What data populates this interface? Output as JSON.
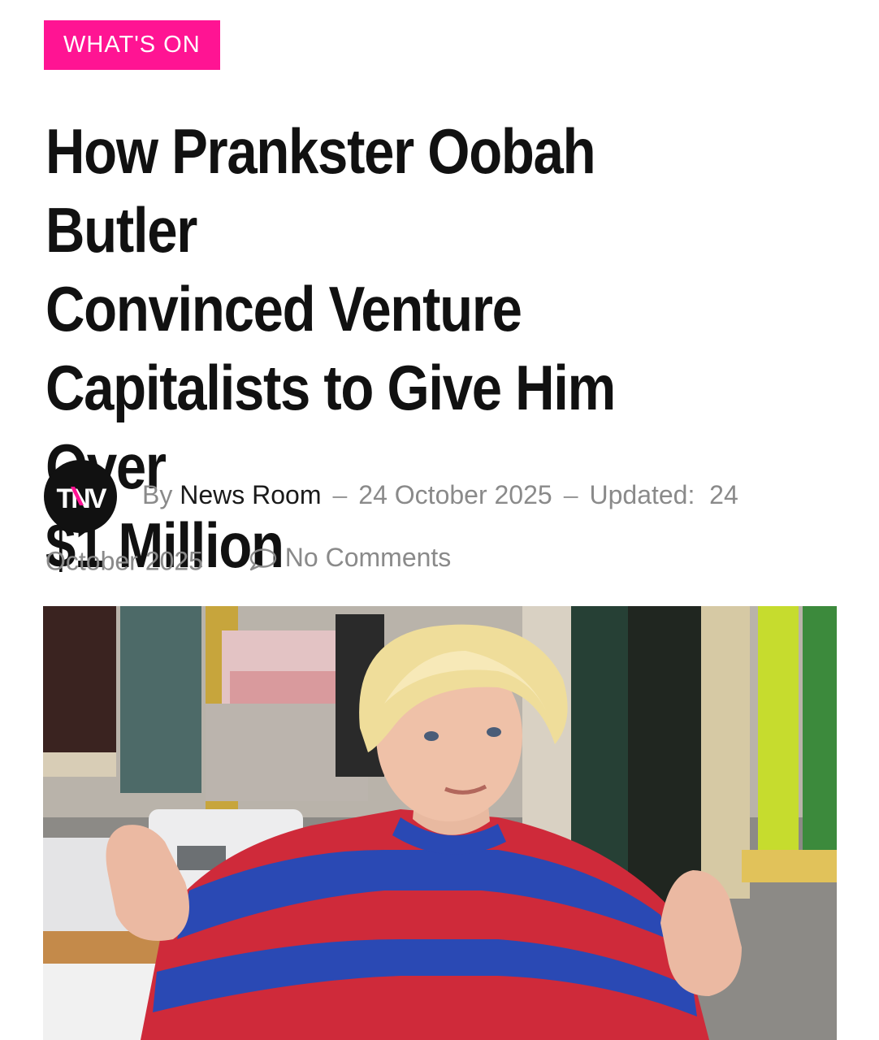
{
  "article": {
    "category": "WHAT'S ON",
    "title_lines": [
      "How Prankster Oobah Butler",
      "Convinced Venture",
      "Capitalists to Give Him Over",
      "$1 Million"
    ],
    "byline": {
      "avatar_text": "TNV",
      "by_prefix": "By",
      "author": "News Room",
      "published": "24 October 2025",
      "updated_label": "Updated:",
      "updated_day": "24",
      "updated_rest": "October 2025"
    },
    "comments": "No Comments",
    "image": {
      "icon": "hero-photo"
    }
  },
  "colors": {
    "accent": "#ff1493",
    "text": "#111111",
    "meta": "#8a8a8a"
  }
}
